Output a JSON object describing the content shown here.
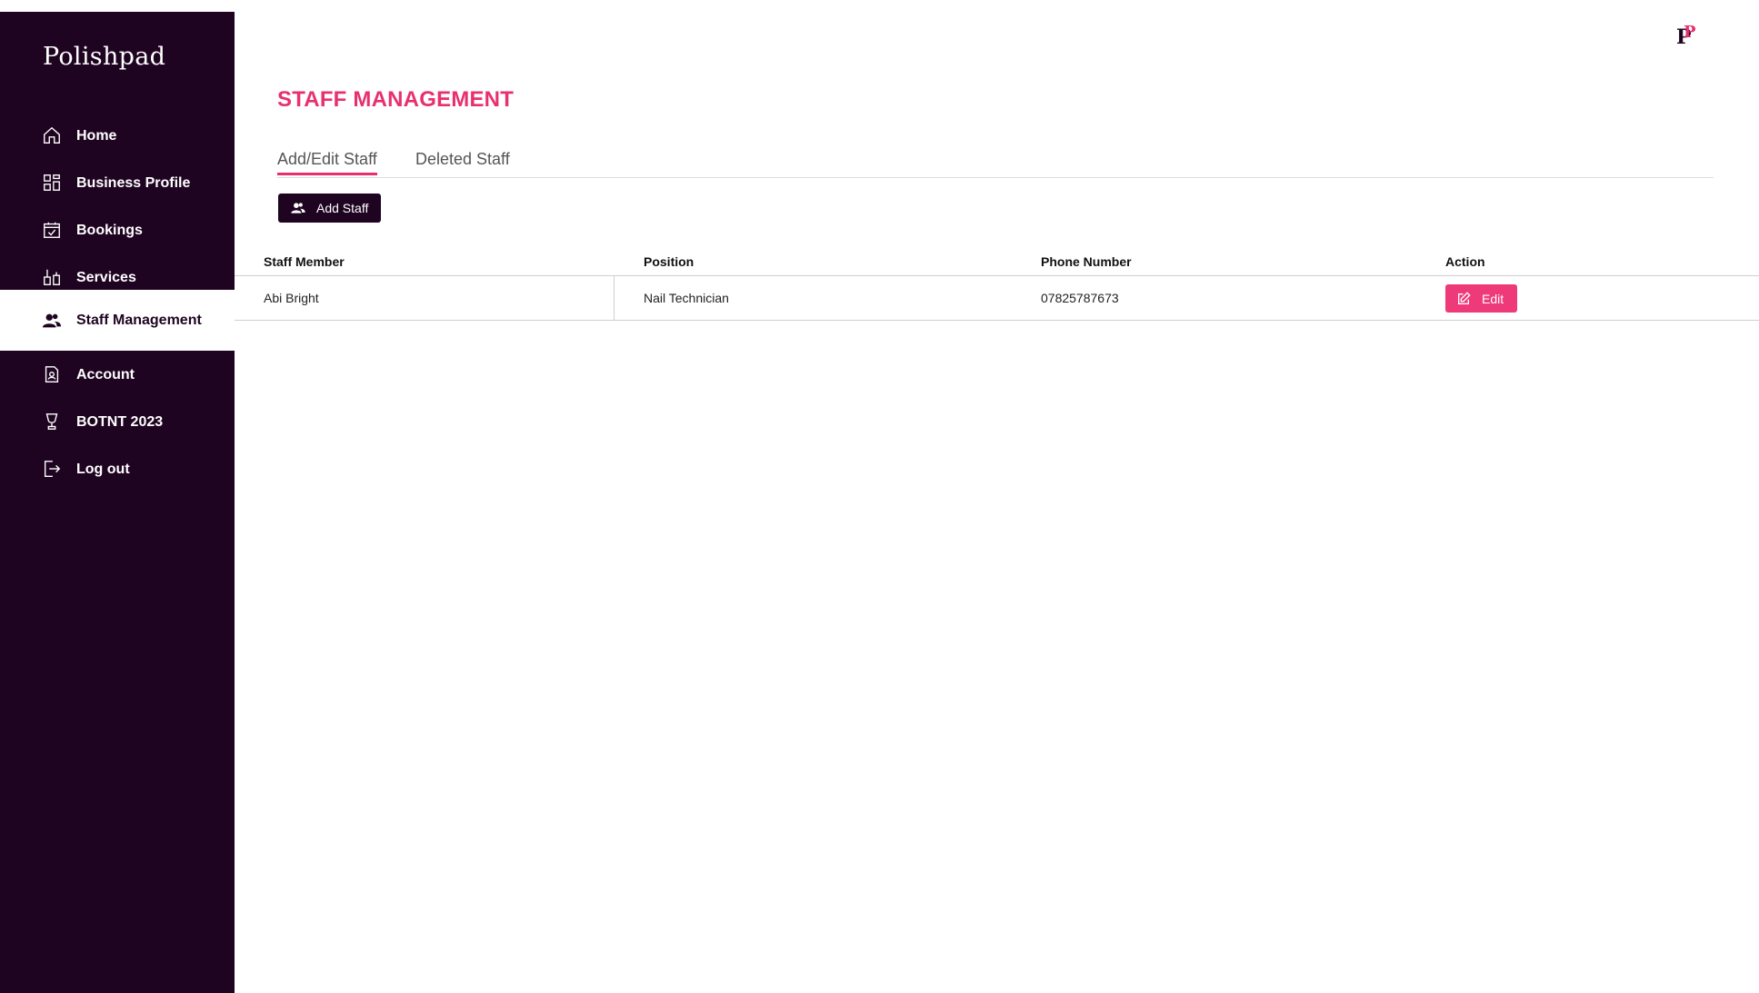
{
  "app": {
    "brand": "Polishpad"
  },
  "sidebar": {
    "items": [
      {
        "label": "Home",
        "icon": "home-icon"
      },
      {
        "label": "Business Profile",
        "icon": "grid-icon"
      },
      {
        "label": "Bookings",
        "icon": "calendar-check-icon"
      },
      {
        "label": "Services",
        "icon": "nail-polish-icon"
      },
      {
        "label": "Staff Management",
        "icon": "users-icon",
        "active": true
      },
      {
        "label": "Account",
        "icon": "id-card-icon"
      },
      {
        "label": "BOTNT 2023",
        "icon": "trophy-icon"
      },
      {
        "label": "Log out",
        "icon": "logout-icon"
      }
    ]
  },
  "header": {
    "title": "STAFF MANAGEMENT"
  },
  "tabs": [
    {
      "label": "Add/Edit Staff",
      "active": true
    },
    {
      "label": "Deleted Staff",
      "active": false
    }
  ],
  "toolbar": {
    "add_label": "Add Staff"
  },
  "table": {
    "columns": [
      "Staff Member",
      "Position",
      "Phone Number",
      "Action"
    ],
    "rows": [
      {
        "name": "Abi Bright",
        "position": "Nail Technician",
        "phone": "07825787673",
        "action_label": "Edit"
      }
    ]
  },
  "colors": {
    "sidebar_bg": "#1f0421",
    "accent": "#e8306f",
    "edit_button": "#ee3a79"
  }
}
